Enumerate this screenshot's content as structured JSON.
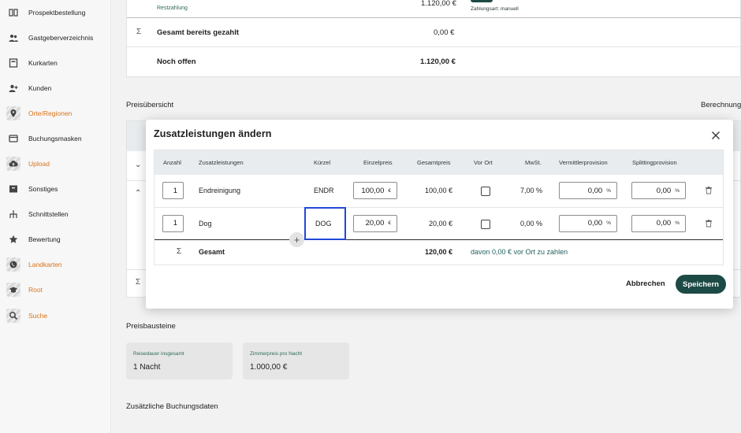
{
  "sidebar": {
    "items": [
      {
        "label": "Prospektbestellung",
        "icon": "book-icon",
        "accent": false
      },
      {
        "label": "Gastgeberverzeichnis",
        "icon": "users-icon",
        "accent": false
      },
      {
        "label": "Kurkarten",
        "icon": "card-icon",
        "accent": false
      },
      {
        "label": "Kunden",
        "icon": "user-add-icon",
        "accent": false
      },
      {
        "label": "Orte/Regionen",
        "icon": "location-pin-icon",
        "accent": true
      },
      {
        "label": "Buchungsmasken",
        "icon": "window-icon",
        "accent": false
      },
      {
        "label": "Upload",
        "icon": "cloud-upload-icon",
        "accent": true
      },
      {
        "label": "Sonstiges",
        "icon": "archive-icon",
        "accent": false
      },
      {
        "label": "Schnittstellen",
        "icon": "hierarchy-icon",
        "accent": false
      },
      {
        "label": "Bewertung",
        "icon": "star-icon",
        "accent": false
      },
      {
        "label": "Landkarten",
        "icon": "globe-icon",
        "accent": true
      },
      {
        "label": "Root",
        "icon": "graduation-cap-icon",
        "accent": true
      },
      {
        "label": "Suche",
        "icon": "search-icon",
        "accent": true
      }
    ]
  },
  "background": {
    "payment_top_amount": "1.120,00 €",
    "payment_top_sub": "Restzahlung",
    "payment_top_method": "Zahlungsart: manuell",
    "sum_paid_label": "Gesamt bereits gezahlt",
    "sum_paid_value": "0,00 €",
    "open_label": "Noch offen",
    "open_value": "1.120,00 €",
    "preisuebersicht": "Preisübersicht",
    "berechnung": "Berechnung",
    "preisbausteine": "Preisbausteine",
    "reisedauer_label": "Reisedauer insgesamt",
    "reisedauer_value": "1 Nacht",
    "zimmerpreis_label": "Zimmerpreis pro Nacht",
    "zimmerpreis_value": "1.000,00 €",
    "zusaetzliche": "Zusätzliche Buchungsdaten",
    "sigma": "Σ"
  },
  "modal": {
    "title": "Zusatzleistungen ändern",
    "columns": {
      "anzahl": "Anzahl",
      "zusatzleistungen": "Zusatzleistungen",
      "kuerzel": "Kürzel",
      "einzelpreis": "Einzelpreis",
      "gesamtpreis": "Gesamtpreis",
      "vor_ort": "Vor Ort",
      "mwst": "MwSt.",
      "vermittler": "Vermittlerprovision",
      "splitting": "Splittingprovision"
    },
    "rows": [
      {
        "anzahl": "1",
        "name": "Endreinigung",
        "kuerzel": "ENDR",
        "einzelpreis": "100,00",
        "einzelpreis_unit": "€",
        "gesamtpreis": "100,00 €",
        "vor_ort": false,
        "mwst": "7,00 %",
        "vermittler": "0,00",
        "vermittler_unit": "%",
        "splitting": "0,00",
        "splitting_unit": "%"
      },
      {
        "anzahl": "1",
        "name": "Dog",
        "kuerzel": "DOG",
        "einzelpreis": "20,00",
        "einzelpreis_unit": "€",
        "gesamtpreis": "20,00 €",
        "vor_ort": false,
        "mwst": "0,00 %",
        "vermittler": "0,00",
        "vermittler_unit": "%",
        "splitting": "0,00",
        "splitting_unit": "%"
      }
    ],
    "sum": {
      "symbol": "Σ",
      "label": "Gesamt",
      "total": "120,00 €",
      "note": "davon 0,00 € vor Ort zu zahlen"
    },
    "add_symbol": "+",
    "cancel_label": "Abbrechen",
    "save_label": "Speichern"
  },
  "colors": {
    "accent_orange": "#d9731a",
    "primary_button": "#1d4a45",
    "focus_border": "#2249d6"
  }
}
